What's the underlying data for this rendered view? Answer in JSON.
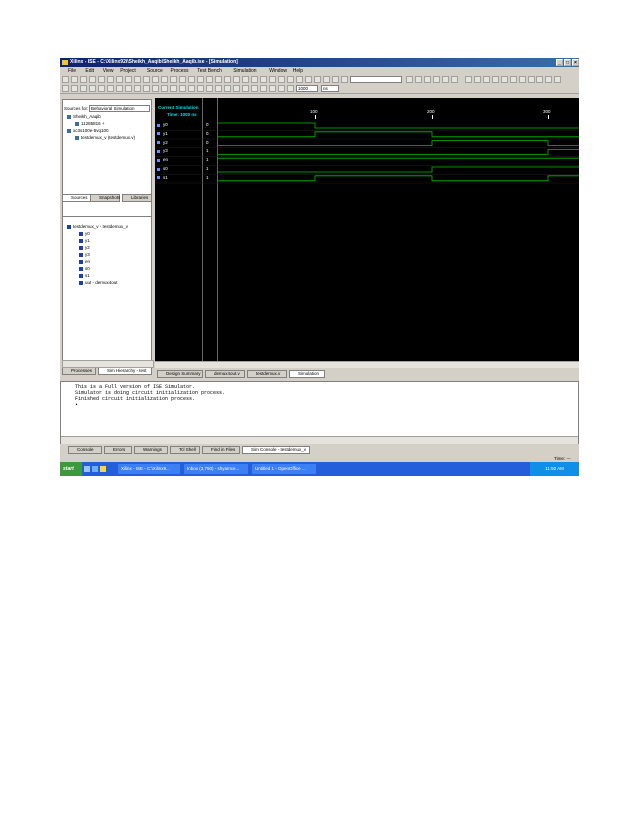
{
  "window": {
    "title": "Xilinx - ISE - C:\\Xilinx92i\\Sheikh_Aaqib\\Sheikh_Aaqib.ise - [Simulation]"
  },
  "menu": [
    "File",
    "Edit",
    "View",
    "Project",
    "Source",
    "Process",
    "Test Bench",
    "Simulation",
    "Window",
    "Help"
  ],
  "toolbar": {
    "sim_time_value": "1000",
    "sim_time_unit": "ns"
  },
  "sources": {
    "sources_for_label": "Sources for:",
    "sources_for_value": "Behavioral Simulation",
    "tree": [
      {
        "label": "Sheikh_Aaqib",
        "indent": 0
      },
      {
        "label": "11285816 +",
        "indent": 1
      },
      {
        "label": "xc3s100e-5vq100",
        "indent": 0
      },
      {
        "label": "testdemux_v (testdemux.v)",
        "indent": 1
      }
    ],
    "tabs": [
      "Sources",
      "Snapshots",
      "Libraries"
    ]
  },
  "hierarchy": {
    "tree": [
      {
        "label": "testdemux_v - testdemux_v",
        "indent": 0
      },
      {
        "label": "y0",
        "indent": 1
      },
      {
        "label": "y1",
        "indent": 1
      },
      {
        "label": "y2",
        "indent": 1
      },
      {
        "label": "y3",
        "indent": 1
      },
      {
        "label": "en",
        "indent": 1
      },
      {
        "label": "s0",
        "indent": 1
      },
      {
        "label": "s1",
        "indent": 1
      },
      {
        "label": "uut - demux4out",
        "indent": 1
      }
    ],
    "tabs": [
      "Processes",
      "Sim Hierarchy - test"
    ]
  },
  "waveform": {
    "current_label": "Current Simulation",
    "time_label": "Time: 1000 ns",
    "ticks": [
      "100",
      "200",
      "300"
    ],
    "signals": [
      {
        "name": "y0",
        "value": "0"
      },
      {
        "name": "y1",
        "value": "0"
      },
      {
        "name": "y2",
        "value": "0"
      },
      {
        "name": "y3",
        "value": "1"
      },
      {
        "name": "en",
        "value": "1"
      },
      {
        "name": "s0",
        "value": "1"
      },
      {
        "name": "s1",
        "value": "1"
      }
    ]
  },
  "doc_tabs": [
    "Design Summary",
    "demux4out.v",
    "testdemux.v",
    "Simulation"
  ],
  "console": {
    "lines": [
      "This is a Full version of ISE Simulator.",
      "Simulator is doing circuit initialization process.",
      "Finished circuit initialization process.",
      "•"
    ],
    "tabs": [
      "Console",
      "Errors",
      "Warnings",
      "Tcl Shell",
      "Find in Files",
      "Sim Console - testdemux_v"
    ]
  },
  "status": {
    "time": "Time: ---"
  },
  "taskbar": {
    "start": "start",
    "items": [
      "Xilinx - ISE - C:\\Xilinx9...",
      "Inbox (3,750) - shyamce...",
      "Untitled 1 - OpenOffice ..."
    ],
    "clock": "11:50 AM"
  }
}
